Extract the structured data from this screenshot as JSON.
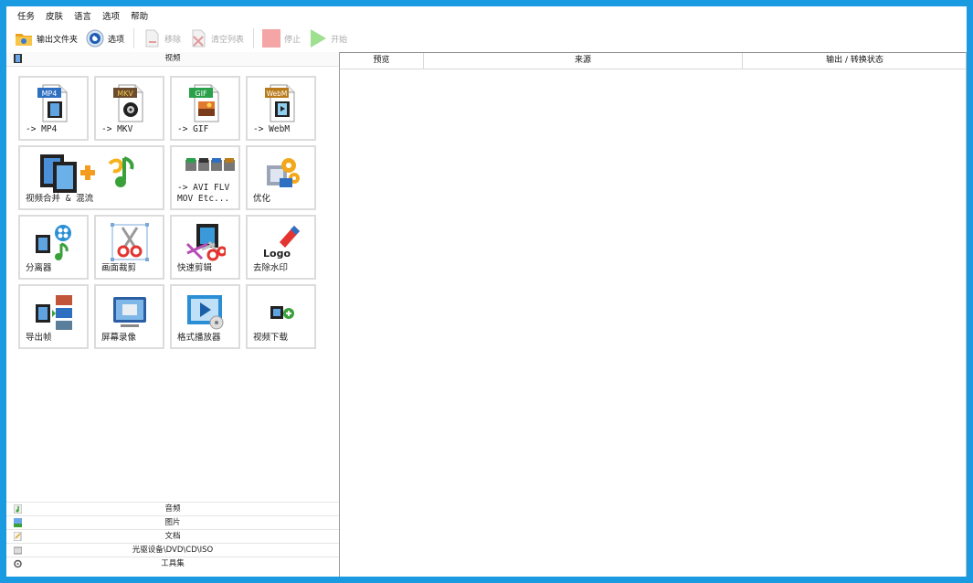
{
  "menu": [
    "任务",
    "皮肤",
    "语言",
    "选项",
    "帮助"
  ],
  "toolbar": {
    "output_folder": "输出文件夹",
    "options": "选项",
    "remove": "移除",
    "clear_list": "清空列表",
    "stop": "停止",
    "start": "开始"
  },
  "categories": {
    "video": "视频",
    "audio": "音频",
    "picture": "图片",
    "document": "文档",
    "disc": "光驱设备\\DVD\\CD\\ISO",
    "tools": "工具集"
  },
  "tiles": {
    "mp4": {
      "label": "-> MP4",
      "badge": "MP4"
    },
    "mkv": {
      "label": "-> MKV",
      "badge": "MKV"
    },
    "gif": {
      "label": "-> GIF",
      "badge": "GIF"
    },
    "webm": {
      "label": "-> WebM",
      "badge": "WebM"
    },
    "merge": {
      "label": "视频合并 & 混流"
    },
    "avi_flv": {
      "label": "-> AVI FLV\nMOV Etc..."
    },
    "optimize": {
      "label": "优化"
    },
    "splitter": {
      "label": "分离器"
    },
    "crop": {
      "label": "画面裁剪"
    },
    "quick_cut": {
      "label": "快速剪辑"
    },
    "remove_watermark": {
      "label": "去除水印",
      "logo_text": "Logo"
    },
    "export_frames": {
      "label": "导出帧"
    },
    "screen_record": {
      "label": "屏幕录像"
    },
    "player": {
      "label": "格式播放器"
    },
    "download": {
      "label": "视频下载"
    }
  },
  "table": {
    "col_preview": "预览",
    "col_source": "来源",
    "col_output": "输出 / 转换状态"
  },
  "colors": {
    "border": "#1a9ae0",
    "mp4": "#2f6fc2",
    "mkv": "#6b4c2e",
    "gif": "#2aa04a",
    "webm": "#b87a1a"
  }
}
